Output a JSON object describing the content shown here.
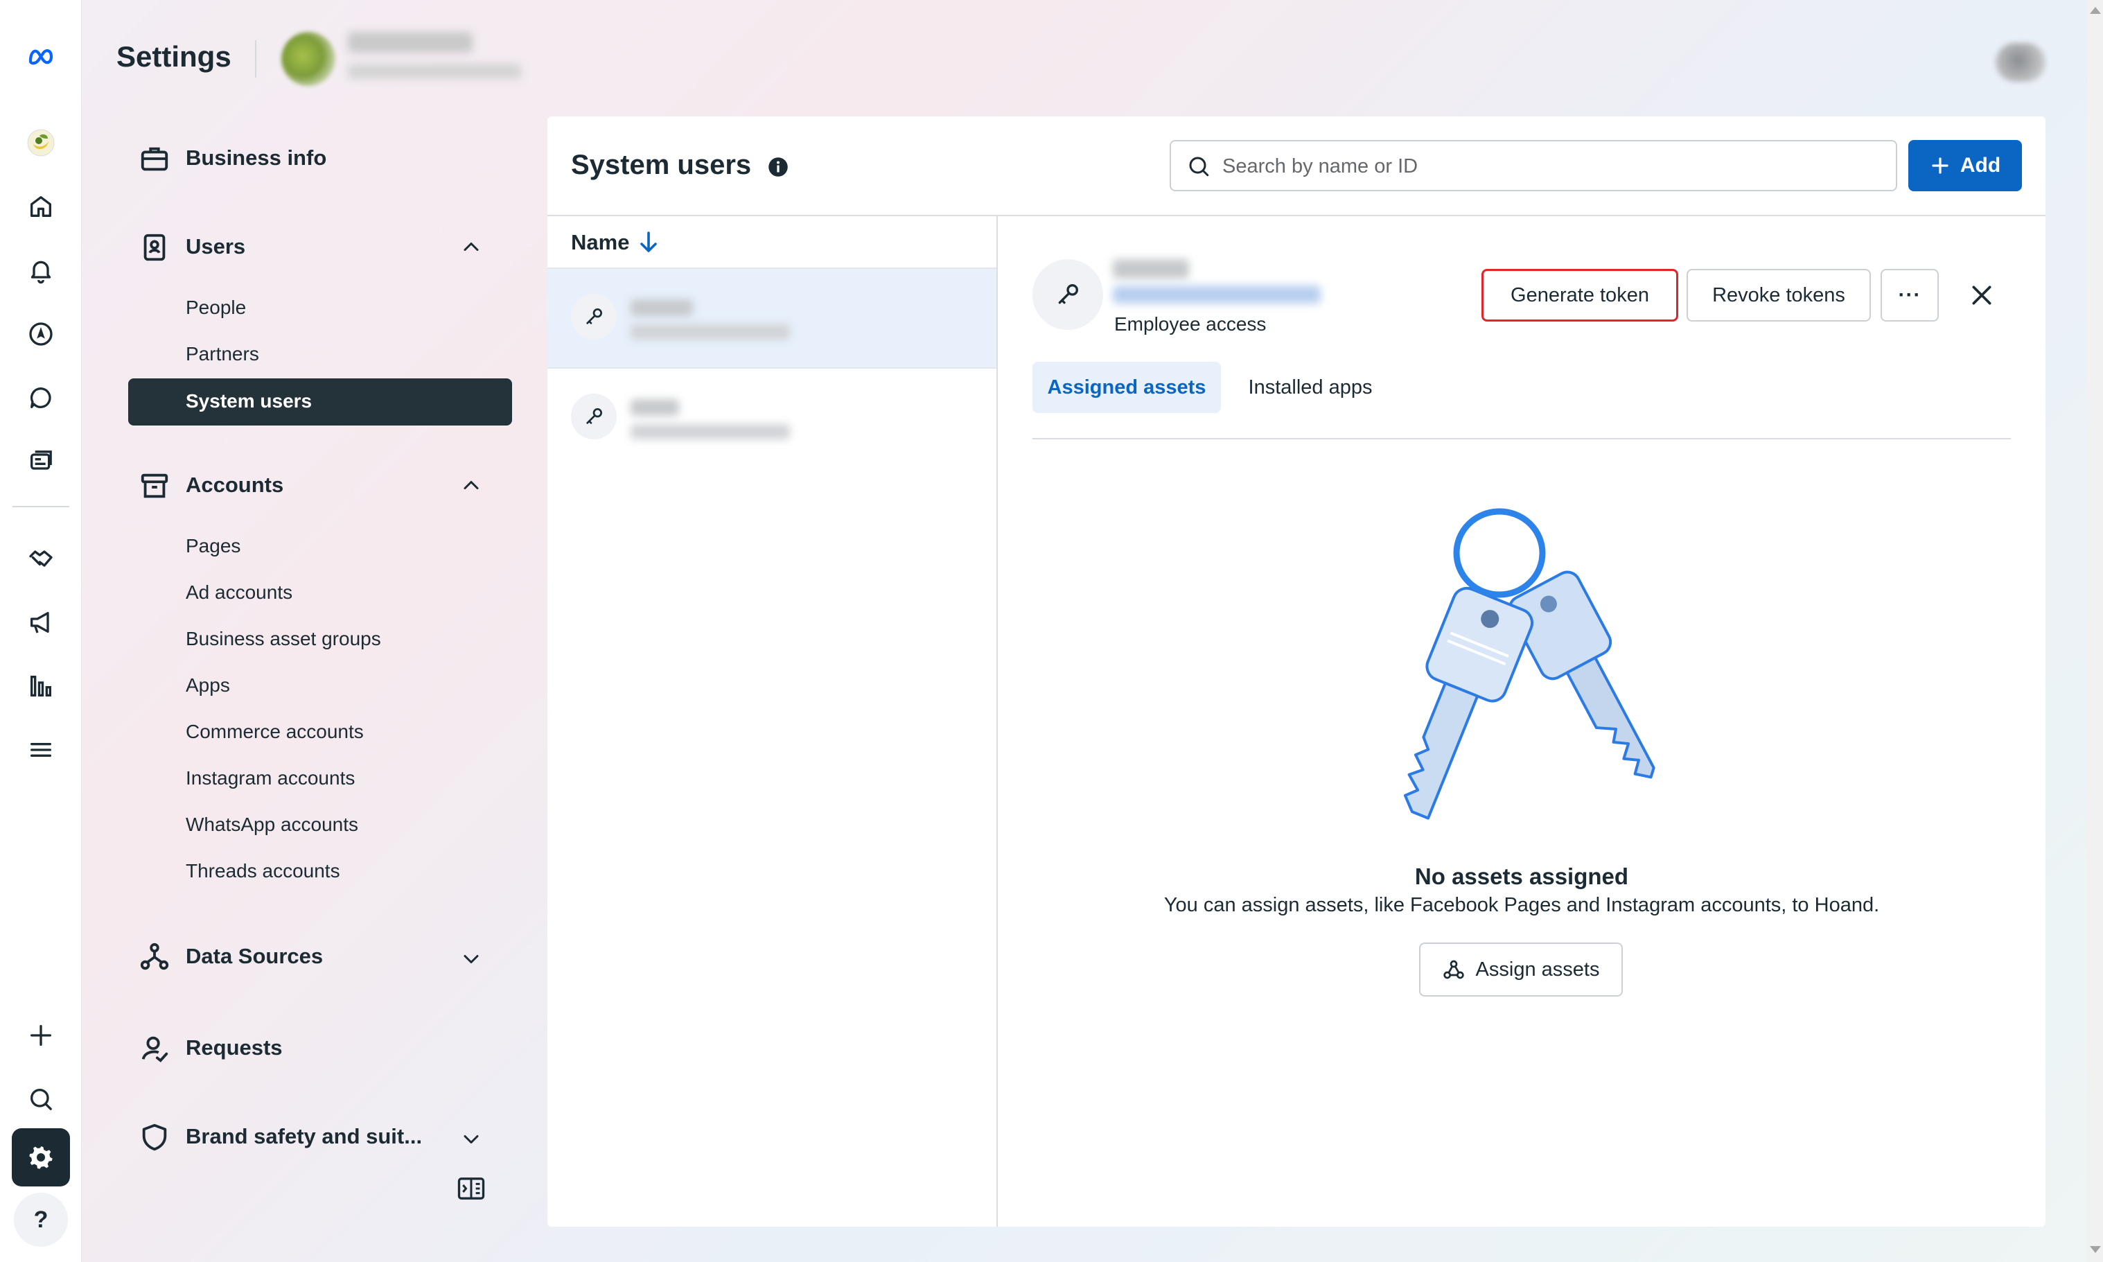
{
  "header": {
    "title": "Settings"
  },
  "sidebar": {
    "business_info": "Business info",
    "users": {
      "label": "Users",
      "items": [
        "People",
        "Partners",
        "System users"
      ]
    },
    "accounts": {
      "label": "Accounts",
      "items": [
        "Pages",
        "Ad accounts",
        "Business asset groups",
        "Apps",
        "Commerce accounts",
        "Instagram accounts",
        "WhatsApp accounts",
        "Threads accounts"
      ]
    },
    "data_sources": "Data Sources",
    "requests": "Requests",
    "brand_safety": "Brand safety and suit..."
  },
  "main": {
    "title": "System users",
    "search_placeholder": "Search by name or ID",
    "add_label": "Add",
    "list_header": "Name",
    "detail": {
      "access": "Employee access",
      "generate_token": "Generate token",
      "revoke_tokens": "Revoke tokens",
      "more": "···",
      "tabs": [
        "Assigned assets",
        "Installed apps"
      ],
      "empty_title": "No assets assigned",
      "empty_desc": "You can assign assets, like Facebook Pages and Instagram accounts, to Hoand.",
      "assign_label": "Assign assets"
    }
  },
  "colors": {
    "primary": "#0a66c2",
    "text": "#1c2b33",
    "nav_active_bg": "#243239",
    "highlight_border": "#e0262c",
    "selected_row": "#e7f0fb"
  },
  "icons": {
    "rail": [
      "meta-logo-icon",
      "business-avatar-icon",
      "home-icon",
      "bell-icon",
      "compass-icon",
      "chat-icon",
      "content-icon",
      "handshake-icon",
      "megaphone-icon",
      "chart-icon",
      "menu-icon",
      "plus-icon",
      "search-icon",
      "gear-icon",
      "help-icon"
    ]
  }
}
